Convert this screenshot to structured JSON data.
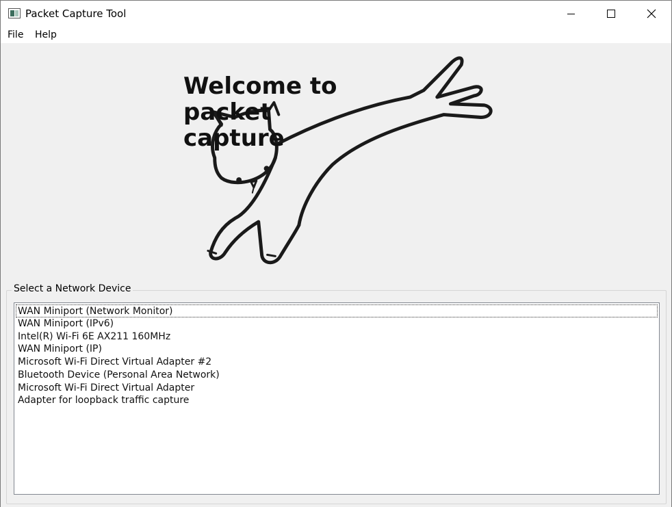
{
  "window": {
    "title": "Packet Capture Tool"
  },
  "menu": {
    "file": "File",
    "help": "Help"
  },
  "banner": {
    "line1": "Welcome to packet",
    "line2": "capture"
  },
  "device_group": {
    "label": "Select a Network Device",
    "items": [
      "WAN Miniport (Network Monitor)",
      "WAN Miniport (IPv6)",
      "Intel(R) Wi-Fi 6E AX211 160MHz",
      "WAN Miniport (IP)",
      "Microsoft Wi-Fi Direct Virtual Adapter #2",
      "Bluetooth Device (Personal Area Network)",
      "Microsoft Wi-Fi Direct Virtual Adapter",
      "Adapter for loopback traffic capture"
    ],
    "focused_index": 0
  },
  "colors": {
    "background": "#f0f0f0",
    "titlebar": "#ffffff",
    "list_bg": "#ffffff",
    "border": "#828790"
  },
  "icons": {
    "app": "app-window-icon",
    "minimize": "minimize-icon",
    "maximize": "maximize-icon",
    "close": "close-icon",
    "illustration": "cat-illustration"
  }
}
